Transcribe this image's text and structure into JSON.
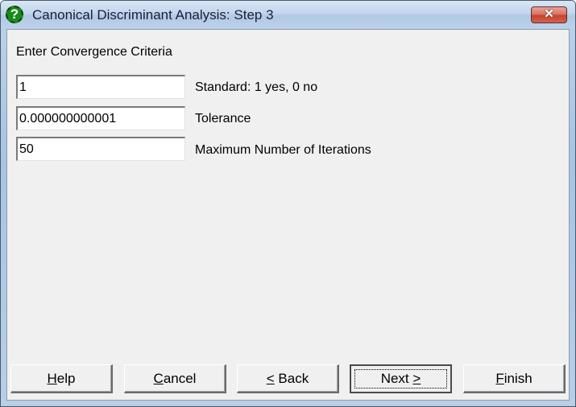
{
  "window": {
    "title": "Canonical Discriminant Analysis: Step 3",
    "icon": "help-question-icon",
    "close_glyph": "✕"
  },
  "section": {
    "label": "Enter Convergence Criteria"
  },
  "fields": [
    {
      "value": "1",
      "label": "Standard: 1 yes, 0 no"
    },
    {
      "value": "0.000000000001",
      "label": "Tolerance"
    },
    {
      "value": "50",
      "label": "Maximum Number of Iterations"
    }
  ],
  "buttons": {
    "help": {
      "mnemonic": "H",
      "rest": "elp"
    },
    "cancel": {
      "mnemonic": "C",
      "rest": "ancel"
    },
    "back": {
      "prefix": "",
      "mnemonic": "<",
      "rest": " Back"
    },
    "next": {
      "prefix": "Next ",
      "mnemonic": ">",
      "rest": ""
    },
    "finish": {
      "mnemonic": "F",
      "rest": "inish"
    }
  },
  "default_button": "next"
}
